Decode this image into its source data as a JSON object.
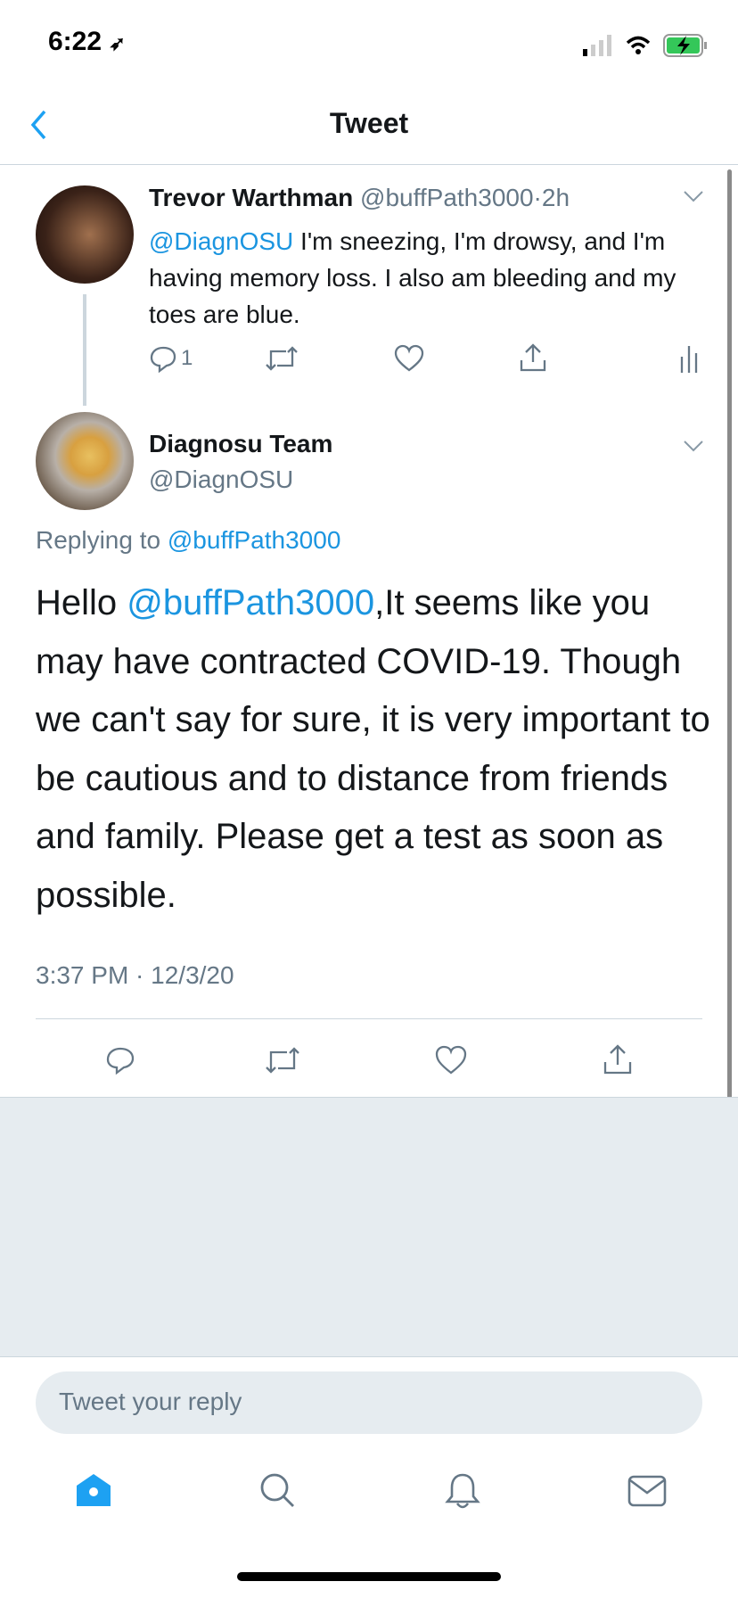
{
  "status_bar": {
    "time": "6:22"
  },
  "nav": {
    "title": "Tweet"
  },
  "tweet1": {
    "name": "Trevor Warthman",
    "handle": "@buffPath3000",
    "separator": "·",
    "age": "2h",
    "mention": "@DiagnOSU",
    "text": " I'm sneezing, I'm drowsy, and I'm having memory loss. I also am bleeding and my toes are blue.",
    "reply_count": "1"
  },
  "tweet2": {
    "name": "Diagnosu Team",
    "handle": "@DiagnOSU",
    "replying_prefix": "Replying to ",
    "replying_to": "@buffPath3000",
    "text_start": "Hello ",
    "mention": "@buffPath3000",
    "text": ",It seems like you may have contracted COVID-19. Though we can't say for sure, it is very important to be cautious and to distance from friends and family. Please get a test as soon as possible.",
    "timestamp": "3:37 PM · 12/3/20"
  },
  "reply_input": {
    "placeholder": "Tweet your reply"
  },
  "colors": {
    "accent": "#1da1f2",
    "muted": "#657786",
    "footer_bg": "#e6ecf0"
  }
}
